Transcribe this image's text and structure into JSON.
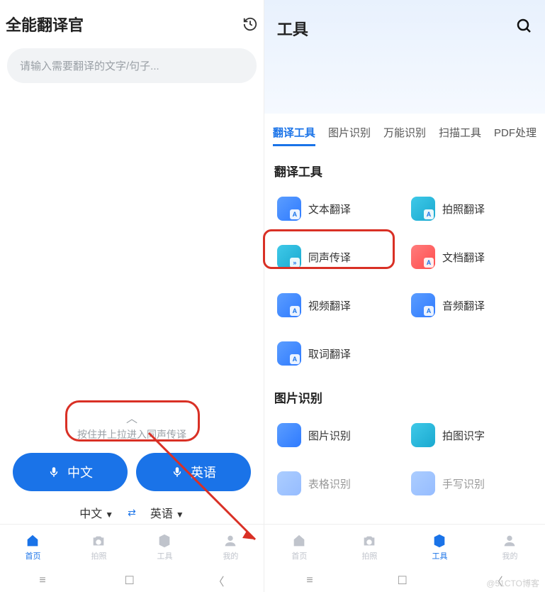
{
  "left": {
    "title": "全能翻译官",
    "search_placeholder": "请输入需要翻译的文字/句子...",
    "hint": "按住并上拉进入同声传译",
    "voice_chinese": "中文",
    "voice_english": "英语",
    "lang_from": "中文",
    "lang_to": "英语",
    "nav": {
      "home": "首页",
      "camera": "拍照",
      "tools": "工具",
      "mine": "我的"
    }
  },
  "right": {
    "title": "工具",
    "tabs": [
      "翻译工具",
      "图片识别",
      "万能识别",
      "扫描工具",
      "PDF处理"
    ],
    "section_translate": "翻译工具",
    "tools_translate": {
      "text": "文本翻译",
      "photo": "拍照翻译",
      "simul": "同声传译",
      "doc": "文档翻译",
      "video": "视频翻译",
      "audio": "音频翻译",
      "word": "取词翻译"
    },
    "section_image": "图片识别",
    "tools_image": {
      "pic_rec": "图片识别",
      "photo_text": "拍图识字",
      "table_rec": "表格识别",
      "hand_rec": "手写识别"
    },
    "nav": {
      "home": "首页",
      "camera": "拍照",
      "tools": "工具",
      "mine": "我的"
    }
  },
  "watermark": "@51CTO博客"
}
